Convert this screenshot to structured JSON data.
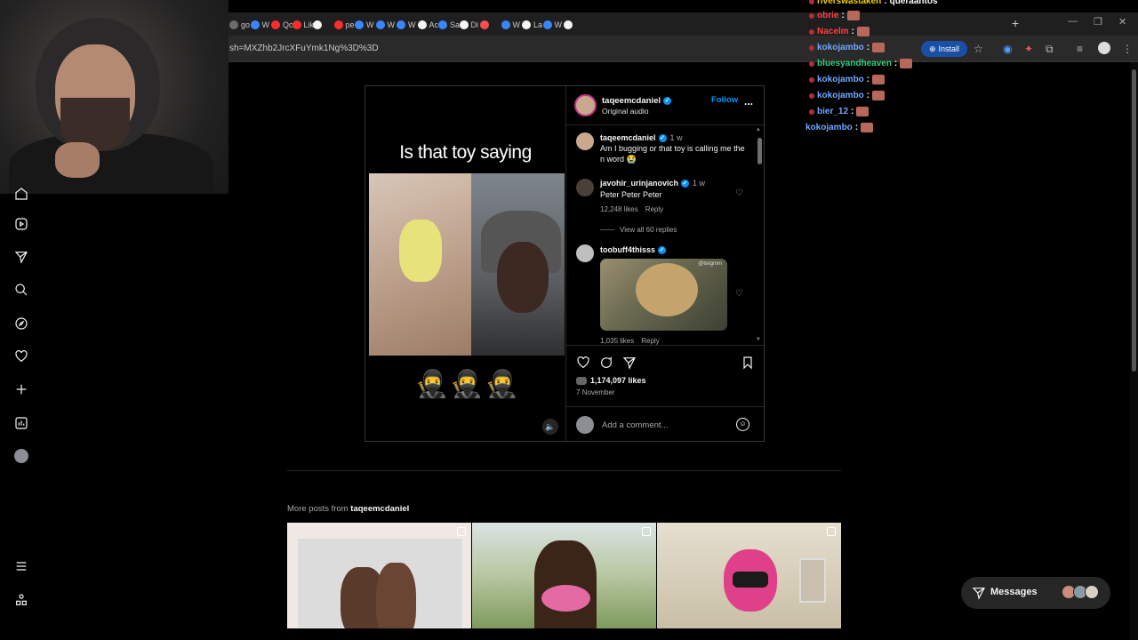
{
  "browser": {
    "tabs": [
      {
        "label": "go",
        "color": "#6c6c6c"
      },
      {
        "label": "W",
        "color": "#3a86ff"
      },
      {
        "label": "Qc",
        "color": "#ff2d2d"
      },
      {
        "label": "Lik",
        "color": "#ff2d2d"
      },
      {
        "label": "",
        "color": "#f5f5f5"
      },
      {
        "label": "pe",
        "color": "#ff2d2d"
      },
      {
        "label": "W",
        "color": "#3a86ff"
      },
      {
        "label": "W",
        "color": "#3a86ff"
      },
      {
        "label": "W",
        "color": "#3a86ff"
      },
      {
        "label": "Ac",
        "color": "#f5f5f5"
      },
      {
        "label": "Sa",
        "color": "#3a86ff"
      },
      {
        "label": "Di",
        "color": "#f5f5f5"
      },
      {
        "label": "",
        "color": "#ff4d4d"
      },
      {
        "label": "W",
        "color": "#3a86ff"
      },
      {
        "label": "La",
        "color": "#f5f5f5"
      },
      {
        "label": "W",
        "color": "#3a86ff"
      },
      {
        "label": "",
        "color": "#f5f5f5"
      }
    ],
    "url": "sh=MXZhb2JrcXFuYmk1Ng%3D%3D",
    "install_label": "Install"
  },
  "chat": [
    {
      "user": "riverswastaken",
      "msg": "queraantos",
      "color": "#f0d000"
    },
    {
      "user": "obrie",
      "msg": "",
      "color": "#ff4040"
    },
    {
      "user": "Nacelm",
      "msg": "",
      "color": "#ff4040"
    },
    {
      "user": "kokojambo",
      "msg": "",
      "color": "#6fa8ff"
    },
    {
      "user": "bluesyandheaven",
      "msg": "",
      "color": "#32d080"
    },
    {
      "user": "kokojambo",
      "msg": "",
      "color": "#6fa8ff"
    },
    {
      "user": "kokojambo",
      "msg": "",
      "color": "#6fa8ff"
    },
    {
      "user": "bier_12",
      "msg": "",
      "color": "#6fa8ff"
    },
    {
      "user": "kokojambo",
      "msg": "",
      "color": "#6fa8ff"
    }
  ],
  "nav": {
    "icons": [
      "reels-icon",
      "direct-icon",
      "search-icon",
      "explore-icon",
      "heart-icon",
      "create-icon",
      "insights-icon"
    ]
  },
  "post": {
    "caption": "Is that toy saying",
    "ninjas": "🥷🥷🥷",
    "mute": "🔈",
    "author": "taqeemcdaniel",
    "audio": "Original audio",
    "follow": "Follow",
    "more": "...",
    "verified_mark": "✓",
    "comments": [
      {
        "user": "taqeemcdaniel",
        "time": "1 w",
        "text": "Am I bugging or that toy is calling me the n word 😭"
      },
      {
        "user": "javohir_urinjanovich",
        "time": "1 w",
        "text": "Peter Peter Peter",
        "likes": "12,248 likes",
        "reply": "Reply"
      },
      {
        "user": "toobuff4thisss",
        "likes": "1,035 likes",
        "reply": "Reply",
        "gif_watermark": "@twigmm"
      }
    ],
    "view_all": "View all 60 replies",
    "like_count": "1,174,097 likes",
    "date": "7 November",
    "add_comment_placeholder": "Add a comment..."
  },
  "more_posts": {
    "prefix": "More posts from ",
    "author": "taqeemcdaniel"
  },
  "messages": {
    "label": "Messages"
  }
}
